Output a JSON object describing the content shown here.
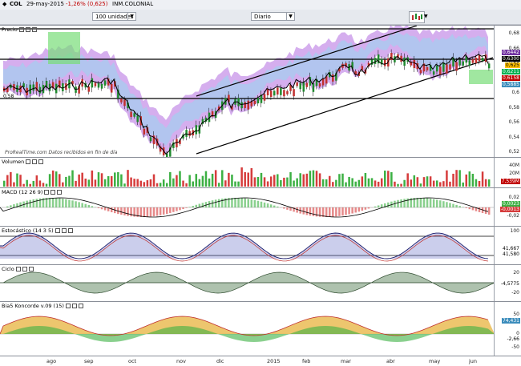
{
  "header": {
    "symbol": "COL",
    "date": "29-may-2015",
    "change": "-1,26% (0,625)",
    "name": "INM.COLONIAL"
  },
  "toolbar": {
    "units_select": "100 unidades",
    "period_select": "Diario"
  },
  "panels": {
    "price": {
      "title": "Precio",
      "ticks": [
        "0,68",
        "0,66",
        "0,64",
        "0,62",
        "0,6",
        "0,58",
        "0,56",
        "0,54",
        "0,52"
      ],
      "tags": [
        {
          "label": "0,6442",
          "color": "#7030a0"
        },
        {
          "label": "0,6300",
          "color": "#000000"
        },
        {
          "label": "0,625",
          "color": "#ffc000"
        },
        {
          "label": "0,6211",
          "color": "#00b050"
        },
        {
          "label": "0,6158",
          "color": "#c00000"
        },
        {
          "label": "0,5885",
          "color": "#3c8dbc"
        }
      ],
      "watermark": "ProRealTime.com  Datos recibidos en fin de día",
      "level_label": "0,58"
    },
    "volume": {
      "title": "Volumen",
      "ticks": [
        "40M",
        "20M"
      ],
      "tag": "7,539M"
    },
    "macd": {
      "title": "MACD (12 26 9)",
      "ticks": [
        "0,02",
        "0",
        "-0,02"
      ],
      "tags": [
        "0,0023",
        "-0,0013"
      ]
    },
    "stoch": {
      "title": "Estocástico (14 3 5)",
      "ticks": [
        "100"
      ],
      "tags": [
        "41,667",
        "41,580"
      ]
    },
    "cycle": {
      "title": "Ciclo",
      "ticks": [
        "20",
        "-4,5775",
        "-20"
      ]
    },
    "bias": {
      "title": "Bia5 Koncorde v.09 (15)",
      "ticks": [
        "50",
        "0",
        "-50"
      ],
      "tags": [
        "74,431",
        "-2,66"
      ]
    }
  },
  "xaxis": {
    "labels": [
      "ago",
      "sep",
      "oct",
      "nov",
      "dic",
      "2015",
      "feb",
      "mar",
      "abr",
      "may",
      "jun"
    ]
  },
  "colors": {
    "cloud_purple": "#b36be0",
    "cloud_green": "#77dd77",
    "cloud_cyan": "#8fdcf0",
    "candle_green": "#1f8a2e",
    "candle_red": "#c0302e",
    "volume_green": "#3cb043",
    "volume_red": "#d63c3c"
  }
}
